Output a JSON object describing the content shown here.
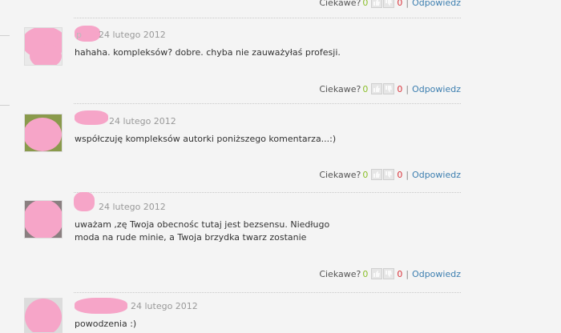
{
  "labels": {
    "interesting": "Ciekawe?",
    "reply": "Odpowiedz",
    "separator": "|"
  },
  "comments": [
    {
      "author": "p",
      "date": "24 lutego 2012",
      "text": "hahaha. kompleksów? dobre. chyba nie zauważyłaś profesji.",
      "votes_up": "0",
      "votes_down": "0"
    },
    {
      "author": "",
      "date": "24 lutego 2012",
      "text": "współczuję kompleksów autorki poniższego komentarza...:)",
      "votes_up": "0",
      "votes_down": "0"
    },
    {
      "author": "",
      "date": "24 lutego 2012",
      "text": "uważam ,zę Twoja obecnośc tutaj jest bezsensu. Niedługo moda na rude minie, a Twoja brzydka twarz zostanie",
      "votes_up": "0",
      "votes_down": "0"
    },
    {
      "author": "",
      "date": "24 lutego 2012",
      "text": "powodzenia :)"
    }
  ],
  "previous_comment": {
    "votes_up": "0",
    "votes_down": "0"
  },
  "colors": {
    "up": "#8bbf2a",
    "down": "#d9363e",
    "link": "#3d7fb0",
    "redaction": "#f6a5c8"
  }
}
